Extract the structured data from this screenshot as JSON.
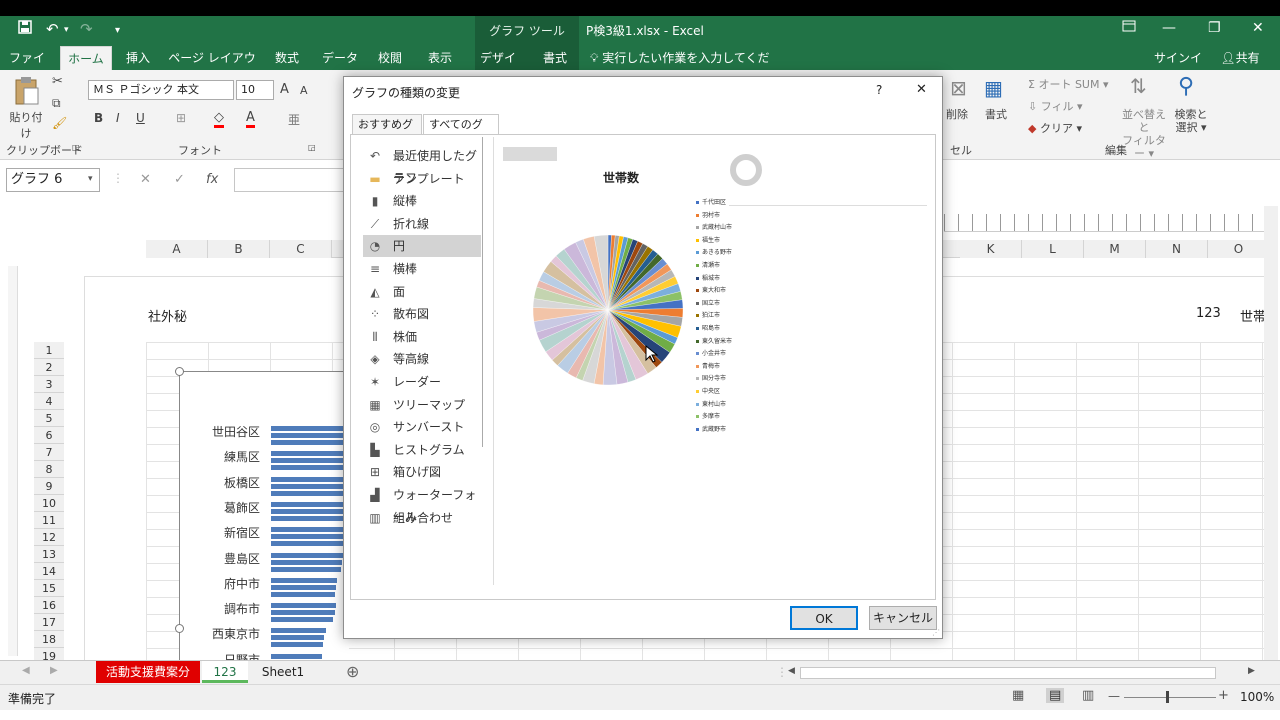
{
  "window": {
    "title": "P検3級1.xlsx - Excel",
    "context_tab": "グラフ ツール",
    "quick_access_more": "▾"
  },
  "tabs": [
    {
      "label": "ファイル"
    },
    {
      "label": "ホーム"
    },
    {
      "label": "挿入"
    },
    {
      "label": "ページ レイアウト"
    },
    {
      "label": "数式"
    },
    {
      "label": "データ"
    },
    {
      "label": "校閲"
    },
    {
      "label": "表示"
    },
    {
      "label": "デザイン"
    },
    {
      "label": "書式"
    }
  ],
  "tellme": "実行したい作業を入力してください...",
  "signin": "サインイン",
  "share": "共有",
  "ribbon": {
    "paste": "貼り付け",
    "clipboard": "クリップボード",
    "font_group": "フォント",
    "font_name": "ＭＳ Ｐゴシック 本文",
    "font_size": "10",
    "font_grow": "A",
    "font_shrink": "A",
    "bold": "B",
    "italic": "I",
    "underline": "U",
    "delete": "削除",
    "format": "書式",
    "cells_group": "セル",
    "autosum": "オート SUM",
    "fill": "フィル",
    "clear": "クリア",
    "sort": "並べ替えと",
    "filter": "フィルター",
    "find": "検索と",
    "select": "選択",
    "edit_group": "編集"
  },
  "formula": {
    "namebox": "グラフ 6",
    "fx": "fx",
    "cancel": "✕",
    "enter": "✓"
  },
  "sheet": {
    "columns": [
      {
        "label": "A"
      },
      {
        "label": "B"
      },
      {
        "label": "C"
      },
      {
        "label": "K"
      },
      {
        "label": "L"
      },
      {
        "label": "M"
      },
      {
        "label": "N"
      },
      {
        "label": "O"
      }
    ],
    "rows": [
      "1",
      "2",
      "3",
      "4",
      "5",
      "6",
      "7",
      "8",
      "9",
      "10",
      "11",
      "12",
      "13",
      "14",
      "15",
      "16",
      "17",
      "18",
      "19"
    ],
    "header_left": "社外秘",
    "header_right_num": "123",
    "header_right_text": "世帯",
    "bar_labels": [
      "世田谷区",
      "練馬区",
      "板橋区",
      "葛飾区",
      "新宿区",
      "豊島区",
      "府中市",
      "調布市",
      "西東京市",
      "日野市"
    ],
    "bar_values": [
      100,
      99,
      98,
      97,
      95,
      93,
      85,
      83,
      70,
      65
    ]
  },
  "sheet_tabs": [
    {
      "label": "活動支援費案分",
      "color": "#e00000"
    },
    {
      "label": "123",
      "color": "#5cb85c"
    },
    {
      "label": "Sheet1",
      "color": ""
    }
  ],
  "status": {
    "ready": "準備完了",
    "zoom": "100%"
  },
  "dialog": {
    "title": "グラフの種類の変更",
    "help": "?",
    "close": "✕",
    "tab_recommended": "おすすめグラフ",
    "tab_all": "すべてのグラフ",
    "categories": [
      {
        "label": "最近使用したグラフ",
        "icon": "undo-icon"
      },
      {
        "label": "テンプレート",
        "icon": "folder-icon"
      },
      {
        "label": "縦棒",
        "icon": "column-chart-icon"
      },
      {
        "label": "折れ線",
        "icon": "line-chart-icon"
      },
      {
        "label": "円",
        "icon": "pie-chart-icon"
      },
      {
        "label": "横棒",
        "icon": "bar-chart-icon"
      },
      {
        "label": "面",
        "icon": "area-chart-icon"
      },
      {
        "label": "散布図",
        "icon": "scatter-chart-icon"
      },
      {
        "label": "株価",
        "icon": "stock-chart-icon"
      },
      {
        "label": "等高線",
        "icon": "surface-chart-icon"
      },
      {
        "label": "レーダー",
        "icon": "radar-chart-icon"
      },
      {
        "label": "ツリーマップ",
        "icon": "treemap-icon"
      },
      {
        "label": "サンバースト",
        "icon": "sunburst-icon"
      },
      {
        "label": "ヒストグラム",
        "icon": "histogram-icon"
      },
      {
        "label": "箱ひげ図",
        "icon": "boxplot-icon"
      },
      {
        "label": "ウォーターフォール",
        "icon": "waterfall-icon"
      },
      {
        "label": "組み合わせ",
        "icon": "combo-chart-icon"
      }
    ],
    "selected_category": 4,
    "ok": "OK",
    "cancel": "キャンセル"
  },
  "chart_data": {
    "type": "pie",
    "title": "世帯数",
    "legend_placement": "right",
    "legend": [
      "千代田区",
      "羽村市",
      "武蔵村山市",
      "福生市",
      "あきる野市",
      "清瀬市",
      "稲城市",
      "東大和市",
      "国立市",
      "狛江市",
      "昭島市",
      "東久留米市",
      "小金井市",
      "青梅市",
      "国分寺市",
      "中央区",
      "東村山市",
      "多摩市",
      "武蔵野市"
    ],
    "slice_count": 53,
    "colors": [
      "#4472c4",
      "#ed7d31",
      "#a5a5a5",
      "#ffc000",
      "#5b9bd5",
      "#70ad47",
      "#264478",
      "#9e480e",
      "#636363",
      "#997300",
      "#255e91",
      "#43682b",
      "#698ed0",
      "#f1975a",
      "#b7b7b7",
      "#ffcd33",
      "#7cafdd",
      "#8cc168"
    ]
  }
}
